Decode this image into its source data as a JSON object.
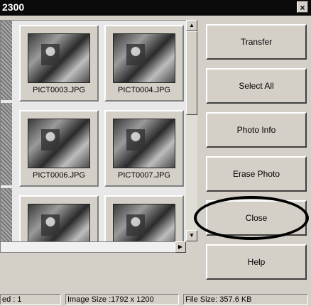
{
  "window": {
    "title": "2300",
    "close_glyph": "×"
  },
  "thumbnails": [
    {
      "filename": "PICT0003.JPG"
    },
    {
      "filename": "PICT0004.JPG"
    },
    {
      "filename": "PICT0006.JPG"
    },
    {
      "filename": "PICT0007.JPG"
    },
    {
      "filename": ""
    },
    {
      "filename": ""
    }
  ],
  "scrollbar": {
    "up_glyph": "▲",
    "down_glyph": "▼",
    "right_glyph": "▶"
  },
  "buttons": {
    "transfer": "Transfer",
    "select_all": "Select All",
    "photo_info": "Photo Info",
    "erase_photo": "Erase Photo",
    "close": "Close",
    "help": "Help"
  },
  "status": {
    "selected": "ed : 1",
    "image_size": "Image Size :1792 x 1200",
    "file_size": "File Size: 357.6 KB"
  }
}
